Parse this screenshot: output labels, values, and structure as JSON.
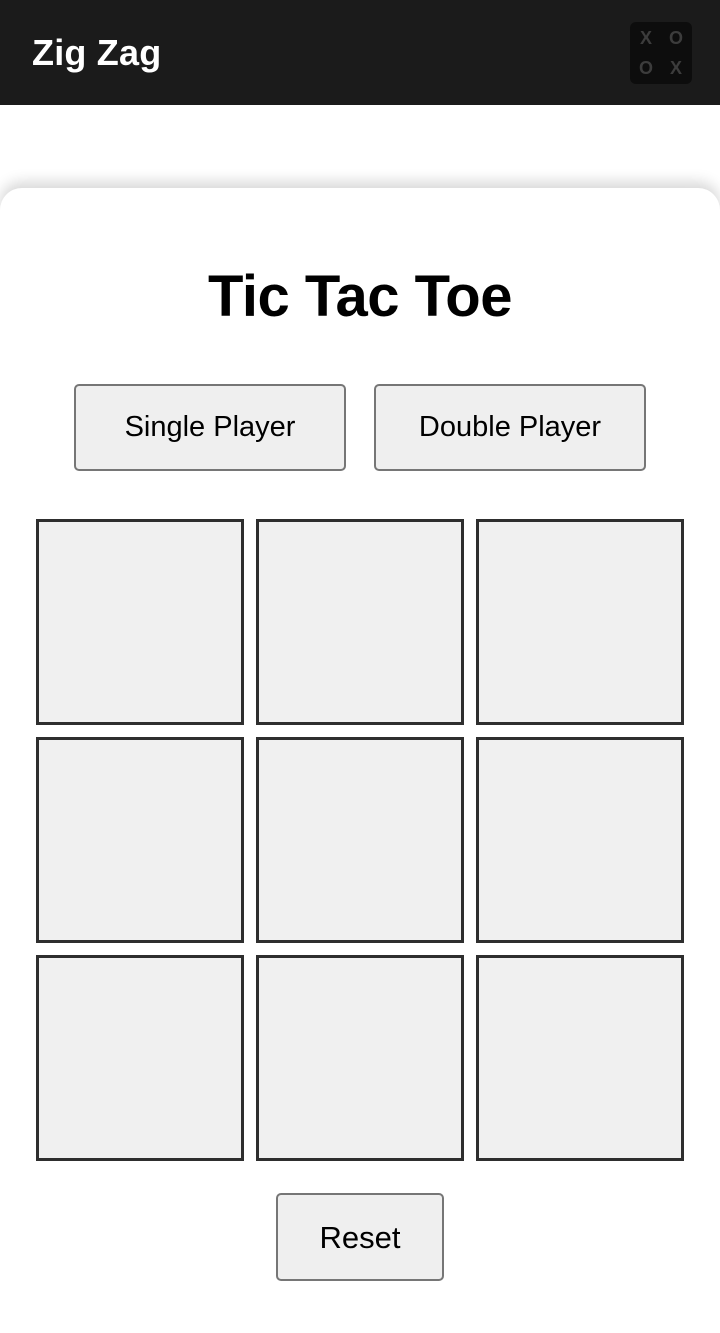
{
  "appbar": {
    "title": "Zig Zag",
    "logo": {
      "name": "tic-tac-toe-logo-icon",
      "cells": [
        "X",
        "O",
        "O",
        "X"
      ]
    }
  },
  "card": {
    "title": "Tic Tac Toe",
    "modes": [
      {
        "label": "Single Player",
        "name": "single-player-button"
      },
      {
        "label": "Double Player",
        "name": "double-player-button"
      }
    ],
    "board": {
      "rows": 3,
      "cols": 3,
      "cells": [
        "",
        "",
        "",
        "",
        "",
        "",
        "",
        "",
        ""
      ]
    },
    "reset": {
      "label": "Reset"
    }
  },
  "colors": {
    "appbar_background": "#1b1b1b",
    "appbar_title": "#ffffff",
    "logo_background": "#0d0d0d",
    "logo_glyph": "#3c3c3c",
    "card_background": "#ffffff",
    "title_text": "#000000",
    "button_background": "#efefef",
    "button_border": "#767676",
    "cell_background": "#f0f0f0",
    "cell_border": "#2e2e2e"
  }
}
